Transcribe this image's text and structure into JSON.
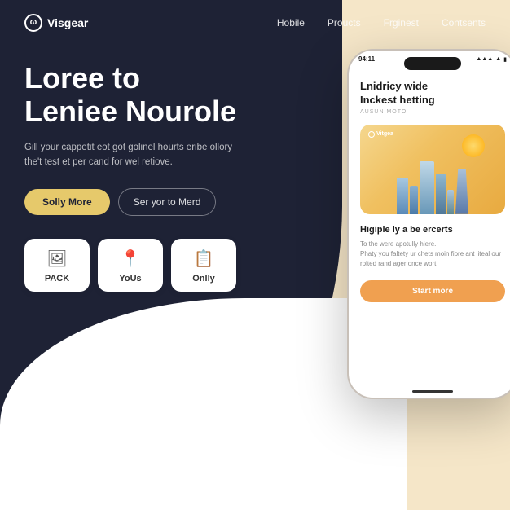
{
  "brand": {
    "logo_icon": "ω",
    "logo_text": "Visgear"
  },
  "nav": {
    "links": [
      {
        "label": "Hobile"
      },
      {
        "label": "Proucts"
      },
      {
        "label": "Frginest"
      },
      {
        "label": "Contsents"
      }
    ]
  },
  "hero": {
    "title_line1": "Loree to",
    "title_line2": "Leniee Nourole",
    "subtitle": "Gill your cappetit eot got golinel hourts eribe ollory the't test et per cand for wel retiove.",
    "btn_primary": "Solly More",
    "btn_outline": "Ser yor to Merd"
  },
  "feature_cards": [
    {
      "label": "PACK",
      "icon": "🖼"
    },
    {
      "label": "YoUs",
      "icon": "📍"
    },
    {
      "label": "Onlly",
      "icon": "📋"
    }
  ],
  "phone": {
    "time": "94:11",
    "app_title_line1": "Lnidricy wide",
    "app_title_line2": "Inckest hetting",
    "app_subtitle": "AUSUN MOTO",
    "logo_small": "Vitgea",
    "card_title": "Higiple ly a be ercerts",
    "card_desc_line1": "To the were apotully hiere.",
    "card_desc_line2": "Phaty you faltety ur chets moin fiore ant liteal our rolted rand ager once wort.",
    "btn_label": "Start more"
  },
  "colors": {
    "dark_bg": "#1e2235",
    "cream_bg": "#f5e6c8",
    "accent_yellow": "#e6c96b",
    "phone_btn": "#f0a050"
  }
}
